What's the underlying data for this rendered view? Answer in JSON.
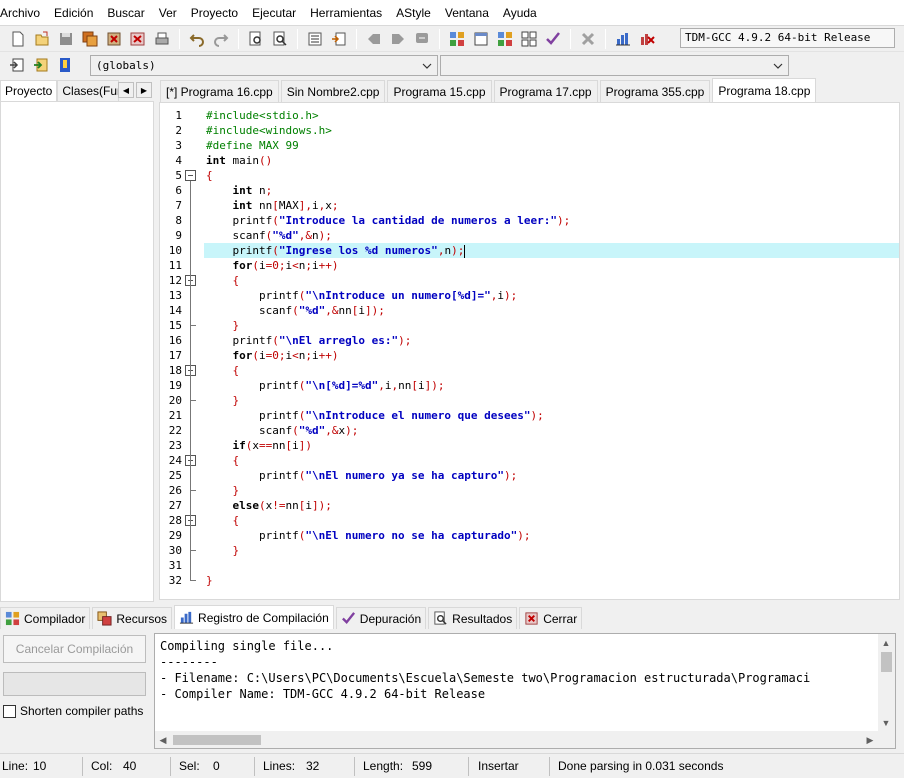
{
  "menu": [
    "Archivo",
    "Edición",
    "Buscar",
    "Ver",
    "Proyecto",
    "Ejecutar",
    "Herramientas",
    "AStyle",
    "Ventana",
    "Ayuda"
  ],
  "compiler_select": "TDM-GCC 4.9.2 64-bit Release",
  "scope_combo": "(globals)",
  "function_combo": "",
  "left_tabs": [
    "Proyecto",
    "Clases(Fun"
  ],
  "editor_tabs": [
    "[*] Programa 16.cpp",
    "Sin Nombre2.cpp",
    "Programa 15.cpp",
    "Programa 17.cpp",
    "Programa 355.cpp",
    "Programa 18.cpp"
  ],
  "active_editor_tab": "Programa 18.cpp",
  "current_line": 10,
  "code_lines": [
    "#include<stdio.h>",
    "#include<windows.h>",
    "#define MAX 99",
    "int main()",
    "{",
    "    int n;",
    "    int nn[MAX],i,x;",
    "    printf(\"Introduce la cantidad de numeros a leer:\");",
    "    scanf(\"%d\",&n);",
    "    printf(\"Ingrese los %d numeros\",n);",
    "    for(i=0;i<n;i++)",
    "    {",
    "        printf(\"\\nIntroduce un numero[%d]=\",i);",
    "        scanf(\"%d\",&nn[i]);",
    "    }",
    "    printf(\"\\nEl arreglo es:\");",
    "    for(i=0;i<n;i++)",
    "    {",
    "        printf(\"\\n[%d]=%d\",i,nn[i]);",
    "    }",
    "        printf(\"\\nIntroduce el numero que desees\");",
    "        scanf(\"%d\",&x);",
    "    if(x==nn[i])",
    "    {",
    "        printf(\"\\nEl numero ya se ha capturo\");",
    "    }",
    "    else(x!=nn[i]);",
    "    {",
    "        printf(\"\\nEl numero no se ha capturado\");",
    "    }",
    "",
    "}"
  ],
  "bottom_tabs": [
    "Compilador",
    "Recursos",
    "Registro de Compilación",
    "Depuración",
    "Resultados",
    "Cerrar"
  ],
  "active_bottom_tab": "Registro de Compilación",
  "cancel_button": "Cancelar Compilación",
  "shorten_paths_label": "Shorten compiler paths",
  "shorten_paths_checked": false,
  "log_lines": [
    "Compiling single file...",
    "--------",
    "- Filename: C:\\Users\\PC\\Documents\\Escuela\\Semeste two\\Programacion estructurada\\Programaci",
    "- Compiler Name: TDM-GCC 4.9.2 64-bit Release"
  ],
  "status": {
    "line_label": "Line:",
    "line": "10",
    "col_label": "Col:",
    "col": "40",
    "sel_label": "Sel:",
    "sel": "0",
    "lines_label": "Lines:",
    "lines": "32",
    "length_label": "Length:",
    "length": "599",
    "mode": "Insertar",
    "message": "Done parsing in 0.031 seconds"
  },
  "colors": {
    "current_line_bg": "#c8f5fa",
    "preprocessor": "#008000",
    "string": "#0000c0",
    "symbol": "#c00000"
  }
}
